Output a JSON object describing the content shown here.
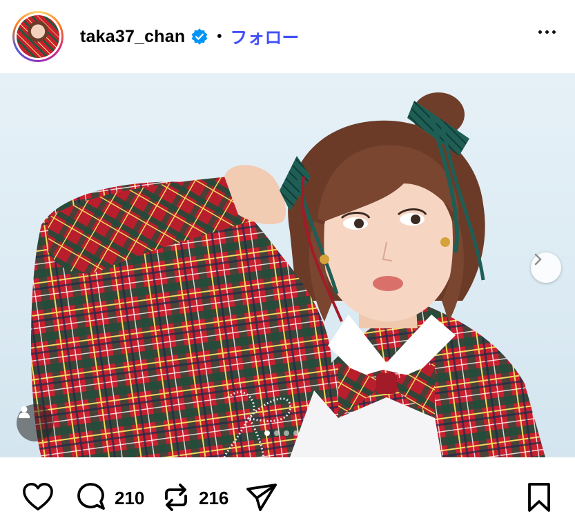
{
  "post": {
    "username": "taka37_chan",
    "separator": "•",
    "follow_label": "フォロー",
    "verified": true,
    "accent_color": "#4150f7"
  },
  "carousel": {
    "slide_count": 4,
    "active_index": 0
  },
  "actions": {
    "like_icon": "heart-icon",
    "comment_icon": "comment-icon",
    "comment_count": "210",
    "repost_icon": "repost-icon",
    "repost_count": "216",
    "share_icon": "send-icon",
    "save_icon": "bookmark-icon"
  }
}
